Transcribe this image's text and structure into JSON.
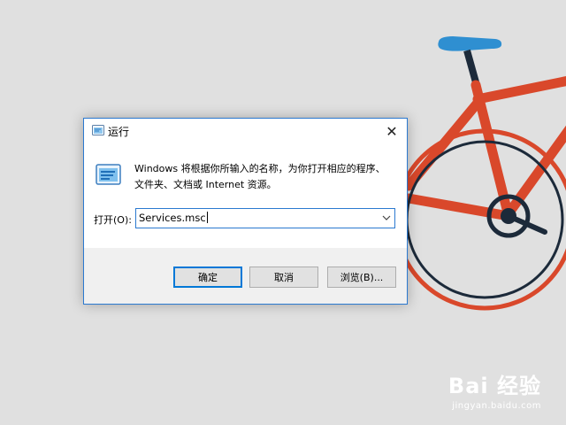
{
  "dialog": {
    "title": "运行",
    "close_symbol": "✕",
    "description_line1": "Windows 将根据你所输入的名称，为你打开相应的程序、",
    "description_line2": "文件夹、文档或 Internet 资源。",
    "open_label": "打开(O):",
    "input_value": "Services.msc",
    "ok_label": "确定",
    "cancel_label": "取消",
    "browse_label": "浏览(B)..."
  },
  "icons": {
    "title": "run-icon",
    "large": "run-icon",
    "close": "close-icon",
    "dropdown": "chevron-down-icon"
  },
  "watermark": {
    "logo_text": "Bai 经验",
    "url": "jingyan.baidu.com"
  },
  "colors": {
    "background": "#e0e0e0",
    "bike_frame": "#d9482b",
    "bike_wheel": "#1c2a3a",
    "bike_saddle": "#2f8fd1",
    "accent": "#0078d7"
  }
}
